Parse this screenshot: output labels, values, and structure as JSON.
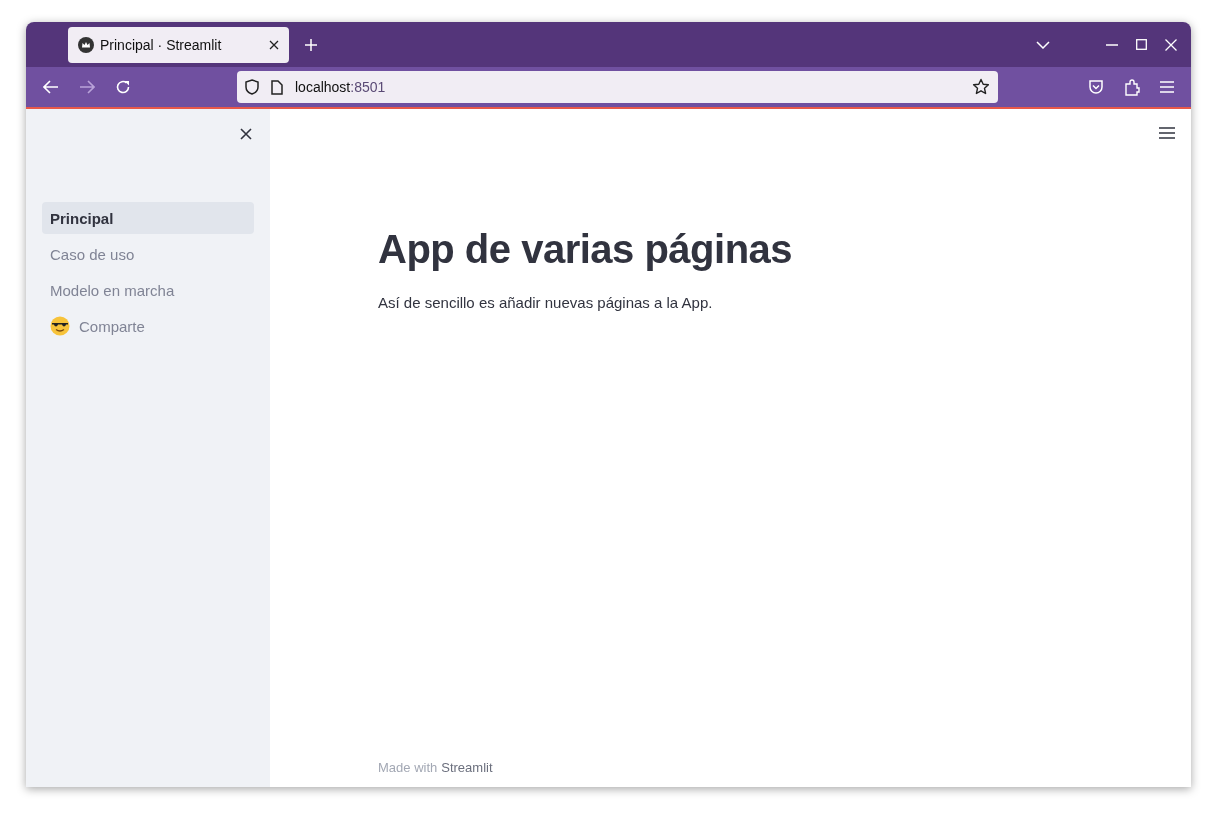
{
  "browser": {
    "tabs": [
      {
        "title": "Principal · Streamlit",
        "selected": true
      }
    ],
    "address": {
      "host": "localhost",
      "port": ":8501"
    }
  },
  "sidebar": {
    "items": [
      {
        "label": "Principal",
        "selected": true,
        "kind": "plain"
      },
      {
        "label": "Caso de uso",
        "selected": false,
        "kind": "plain"
      },
      {
        "label": "Modelo en marcha",
        "selected": false,
        "kind": "plain"
      },
      {
        "label": "Comparte",
        "selected": false,
        "kind": "emoji"
      }
    ]
  },
  "main": {
    "title": "App de varias páginas",
    "text": "Así de sencillo es añadir nuevas páginas a la App."
  },
  "footer": {
    "prefix": "Made with",
    "link": "Streamlit"
  }
}
